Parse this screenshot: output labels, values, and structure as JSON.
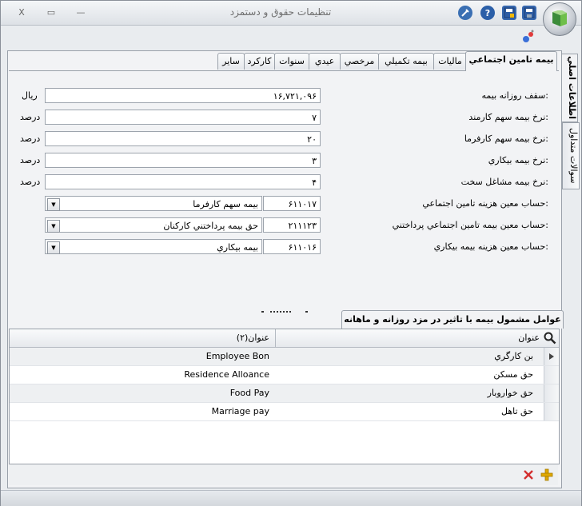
{
  "window": {
    "title": "تنظيمات حقوق و دستمزد"
  },
  "window_controls": {
    "close": "X",
    "restore": "▭",
    "minimize": "—"
  },
  "tabs": [
    {
      "label": "بيمه تامين اجتماعي",
      "active": true
    },
    {
      "label": "ماليات"
    },
    {
      "label": "بيمه تكميلي"
    },
    {
      "label": "مرخصي"
    },
    {
      "label": "عيدي"
    },
    {
      "label": "سنوات"
    },
    {
      "label": "كاركرد"
    },
    {
      "label": "ساير"
    }
  ],
  "side_tabs": [
    {
      "label": "اطلاعات اصلي",
      "active": true
    },
    {
      "label": "سوالات متداول"
    }
  ],
  "form": {
    "fields": [
      {
        "label": "سقف روزانه بيمه:",
        "value": "۱۶,۷۲۱,۰۹۶",
        "unit": "ريال"
      },
      {
        "label": "نرخ بيمه سهم كارمند:",
        "value": "۷",
        "unit": "درصد"
      },
      {
        "label": "نرخ بيمه سهم كارفرما:",
        "value": "۲۰",
        "unit": "درصد"
      },
      {
        "label": "نرخ بيمه بيكاري:",
        "value": "۳",
        "unit": "درصد"
      },
      {
        "label": "نرخ بيمه مشاغل سخت:",
        "value": "۴",
        "unit": "درصد"
      }
    ],
    "accounts": [
      {
        "label": "حساب معين هزينه تامين اجتماعي:",
        "code": "۶۱۱۰۱۷",
        "name": "بيمه سهم كارفرما"
      },
      {
        "label": "حساب معين بيمه تامين اجتماعي پرداختني:",
        "code": "۲۱۱۱۲۳",
        "name": "حق بيمه پرداختني كاركنان"
      },
      {
        "label": "حساب معين هزينه بيمه بيكاري:",
        "code": "۶۱۱۰۱۶",
        "name": "بيمه بيكاري"
      }
    ]
  },
  "grid": {
    "tab_label": "عوامل مشمول بيمه با تاثير در مزد روزانه و ماهانه",
    "columns": [
      "عنوان",
      "عنوان(۲)"
    ],
    "rows": [
      [
        "بن كارگري",
        "Employee Bon"
      ],
      [
        "حق مسكن",
        "Residence Alloance"
      ],
      [
        "حق خواروبار",
        "Food Pay"
      ],
      [
        "حق تاهل",
        "Marriage pay"
      ]
    ]
  },
  "colors": {
    "accent": "#2b6cb0",
    "add": "#e0a800",
    "delete": "#d32f2f"
  }
}
